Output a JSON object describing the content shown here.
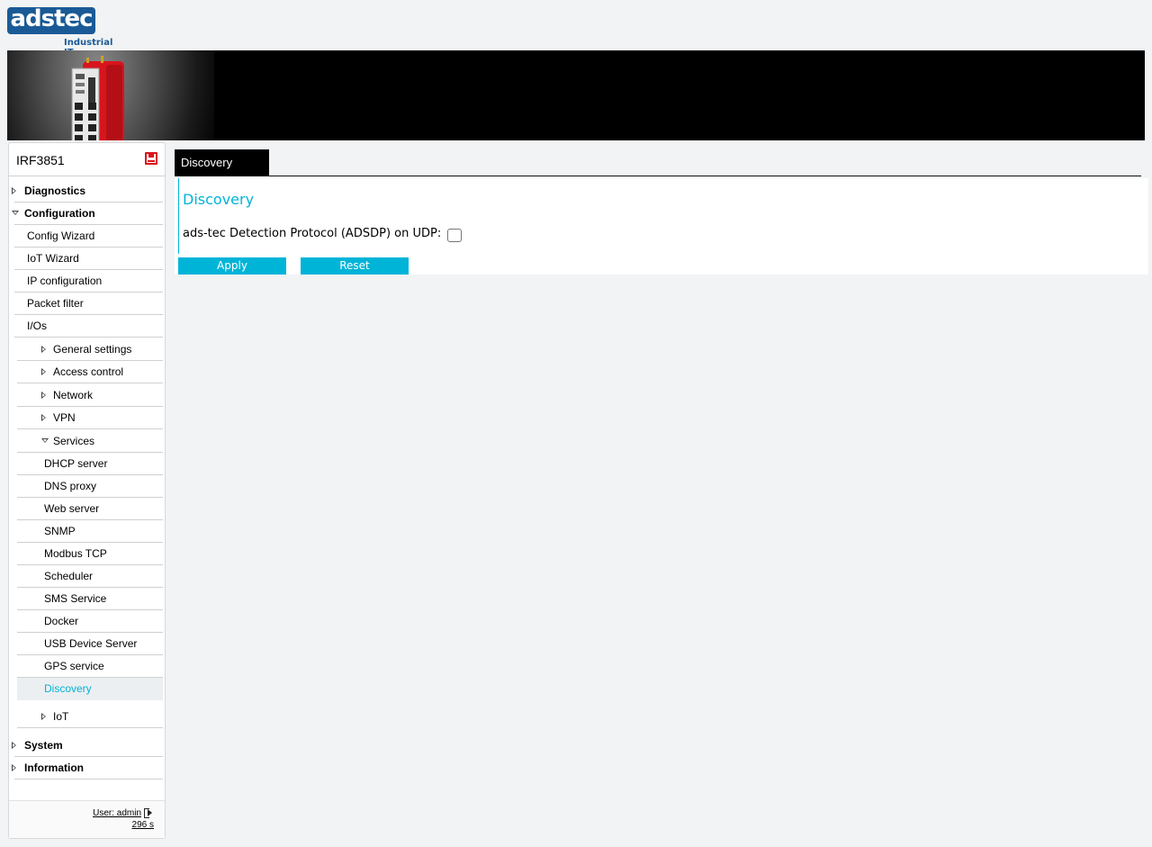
{
  "brand": {
    "logo_text": "adstec",
    "tagline": "Industrial IT"
  },
  "device": {
    "name": "IRF3851"
  },
  "sidebar": {
    "items": [
      {
        "label": "Diagnostics"
      },
      {
        "label": "Configuration"
      },
      {
        "label": "Config Wizard"
      },
      {
        "label": "IoT Wizard"
      },
      {
        "label": "IP configuration"
      },
      {
        "label": "Packet filter"
      },
      {
        "label": "I/Os"
      },
      {
        "label": "General settings"
      },
      {
        "label": "Access control"
      },
      {
        "label": "Network"
      },
      {
        "label": "VPN"
      },
      {
        "label": "Services"
      },
      {
        "label": "DHCP server"
      },
      {
        "label": "DNS proxy"
      },
      {
        "label": "Web server"
      },
      {
        "label": "SNMP"
      },
      {
        "label": "Modbus TCP"
      },
      {
        "label": "Scheduler"
      },
      {
        "label": "SMS Service"
      },
      {
        "label": "Docker"
      },
      {
        "label": "USB Device Server"
      },
      {
        "label": "GPS service"
      },
      {
        "label": "Discovery"
      },
      {
        "label": "IoT"
      },
      {
        "label": "System"
      },
      {
        "label": "Information"
      }
    ],
    "footer": {
      "user": "User: admin",
      "timer": "296 s"
    }
  },
  "main": {
    "tab": "Discovery",
    "title": "Discovery",
    "field_label": "ads-tec Detection Protocol (ADSDP) on UDP:",
    "checkbox_checked": false,
    "apply_label": "Apply",
    "reset_label": "Reset"
  },
  "colors": {
    "accent": "#00b4d8",
    "brand_blue": "#1a5a96",
    "save_red": "#d9141c"
  }
}
